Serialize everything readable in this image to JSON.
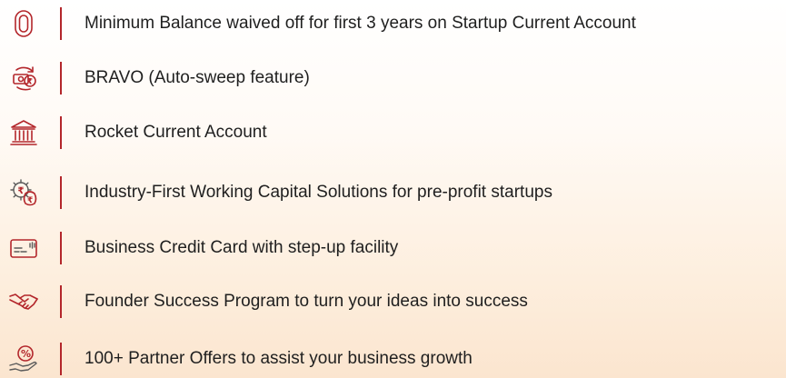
{
  "features": [
    {
      "icon": "zero-balance-icon",
      "text": "Minimum Balance waived off for first 3 years on Startup Current Account"
    },
    {
      "icon": "auto-sweep-icon",
      "text": "BRAVO (Auto-sweep feature)"
    },
    {
      "icon": "bank-building-icon",
      "text": "Rocket Current Account"
    },
    {
      "icon": "working-capital-icon",
      "text": "Industry-First Working Capital Solutions for pre-profit startups"
    },
    {
      "icon": "credit-card-icon",
      "text": "Business Credit Card with step-up facility"
    },
    {
      "icon": "handshake-icon",
      "text": "Founder Success Program to turn your ideas into success"
    },
    {
      "icon": "partner-offer-icon",
      "text": "100+ Partner Offers to assist your business growth"
    }
  ],
  "colors": {
    "accent": "#b3262b",
    "text": "#1f1f1f",
    "background_start": "#ffffff",
    "background_end": "#fbe5cf"
  }
}
